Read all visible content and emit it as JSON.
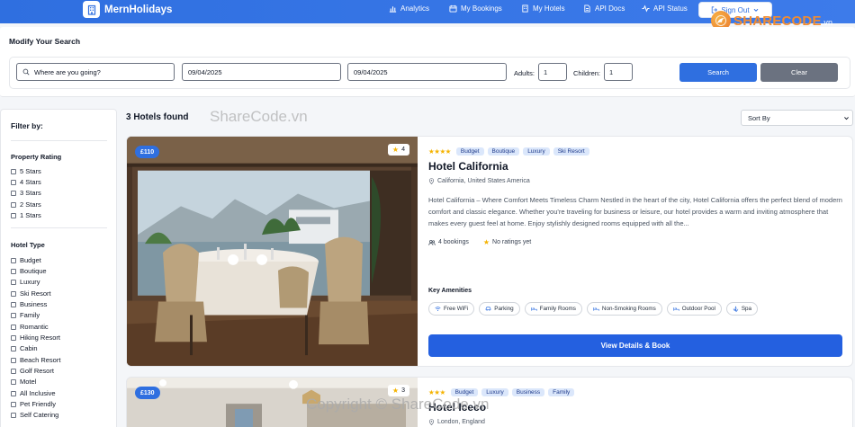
{
  "header": {
    "brand": "MernHolidays",
    "nav": [
      {
        "label": "Analytics",
        "icon": "chart-icon"
      },
      {
        "label": "My Bookings",
        "icon": "calendar-icon"
      },
      {
        "label": "My Hotels",
        "icon": "building-icon"
      },
      {
        "label": "API Docs",
        "icon": "document-icon"
      },
      {
        "label": "API Status",
        "icon": "pulse-icon"
      }
    ],
    "sign_out": "Sign Out"
  },
  "watermark": {
    "brand": "SHARECODE",
    "domain": ".vn",
    "text": "ShareCode.vn",
    "copyright": "Copyright © ShareCode.vn"
  },
  "search": {
    "title": "Modify Your Search",
    "destination_placeholder": "Where are you going?",
    "check_in": "09/04/2025",
    "check_out": "09/04/2025",
    "adults_label": "Adults:",
    "adults": "1",
    "children_label": "Children:",
    "children": "1",
    "search_button": "Search",
    "clear_button": "Clear"
  },
  "filters": {
    "title": "Filter by:",
    "rating_title": "Property Rating",
    "ratings": [
      "5 Stars",
      "4 Stars",
      "3 Stars",
      "2 Stars",
      "1 Stars"
    ],
    "type_title": "Hotel Type",
    "types": [
      "Budget",
      "Boutique",
      "Luxury",
      "Ski Resort",
      "Business",
      "Family",
      "Romantic",
      "Hiking Resort",
      "Cabin",
      "Beach Resort",
      "Golf Resort",
      "Motel",
      "All Inclusive",
      "Pet Friendly",
      "Self Catering"
    ]
  },
  "results": {
    "count_label": "3 Hotels found",
    "sort_label": "Sort By"
  },
  "hotels": [
    {
      "price": "£110",
      "star_badge": "4",
      "stars": "★★★★",
      "tags": [
        "Budget",
        "Boutique",
        "Luxury",
        "Ski Resort"
      ],
      "name": "Hotel California",
      "location": "California, United States America",
      "description": "Hotel California – Where Comfort Meets Timeless Charm Nestled in the heart of the city, Hotel California offers the perfect blend of modern comfort and classic elegance. Whether you're traveling for business or leisure, our hotel provides a warm and inviting atmosphere that makes every guest feel at home. Enjoy stylishly designed rooms equipped with all the...",
      "bookings": "4 bookings",
      "rating": "No ratings yet",
      "amenities_title": "Key Amenities",
      "amenities": [
        {
          "label": "Free WiFi",
          "icon": "wifi-icon"
        },
        {
          "label": "Parking",
          "icon": "car-icon"
        },
        {
          "label": "Family Rooms",
          "icon": "bed-icon"
        },
        {
          "label": "Non-Smoking Rooms",
          "icon": "bed-icon"
        },
        {
          "label": "Outdoor Pool",
          "icon": "bed-icon"
        },
        {
          "label": "Spa",
          "icon": "spa-icon"
        }
      ],
      "cta": "View Details & Book"
    },
    {
      "price": "£130",
      "star_badge": "3",
      "stars": "★★★",
      "tags": [
        "Budget",
        "Luxury",
        "Business",
        "Family"
      ],
      "name": "Hotel Iceco",
      "location": "London, England"
    }
  ],
  "colors": {
    "primary": "#2f6fe0",
    "secondary": "#6b7280",
    "tag_bg": "#dbe7fb",
    "star": "#f5b301"
  }
}
